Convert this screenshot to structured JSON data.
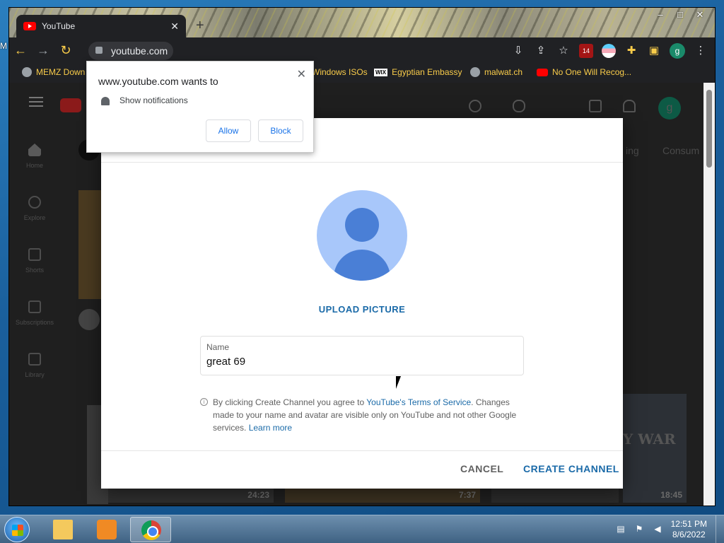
{
  "desktop": {
    "edge_label": "M"
  },
  "browser": {
    "tab_title": "YouTube",
    "url": "youtube.com",
    "window_buttons": [
      "–",
      "□",
      "✕"
    ],
    "ext_badge": "14",
    "profile_initial": "g",
    "bookmarks": [
      {
        "label": "MEMZ Down",
        "icon": "globe-icon"
      },
      {
        "label": "Windows ISOs",
        "icon": "globe-icon"
      },
      {
        "label": "Egyptian Embassy",
        "icon": "wix-icon"
      },
      {
        "label": "malwat.ch",
        "icon": "globe-icon"
      },
      {
        "label": "No One Will Recog...",
        "icon": "youtube-icon"
      }
    ]
  },
  "youtube": {
    "avatar_initial": "g",
    "chips": [
      "ing",
      "Consum"
    ],
    "sidebar": [
      {
        "label": "Home",
        "icon": "home-icon"
      },
      {
        "label": "Explore",
        "icon": "compass-icon"
      },
      {
        "label": "Shorts",
        "icon": "shorts-icon"
      },
      {
        "label": "Subscriptions",
        "icon": "subscriptions-icon"
      },
      {
        "label": "Library",
        "icon": "library-icon"
      }
    ],
    "video_durations": [
      "24:23",
      "7:37",
      "18:45"
    ],
    "thumb_text": "Y WAR"
  },
  "dialog": {
    "upload_label": "UPLOAD PICTURE",
    "name_label": "Name",
    "name_value": "great 69",
    "terms_prefix": "By clicking Create Channel you agree to ",
    "terms_link": "YouTube's Terms of Service",
    "terms_suffix": ". Changes made to your name and avatar are visible only on YouTube and not other Google services. ",
    "learn_more": "Learn more",
    "cancel_label": "CANCEL",
    "create_label": "CREATE CHANNEL"
  },
  "notification": {
    "title": "www.youtube.com wants to",
    "text": "Show notifications",
    "allow_label": "Allow",
    "block_label": "Block"
  },
  "taskbar": {
    "time": "12:51 PM",
    "date": "8/6/2022"
  }
}
